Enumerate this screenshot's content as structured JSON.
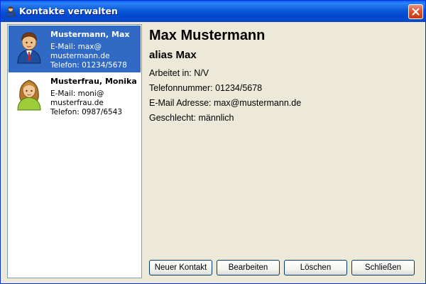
{
  "window": {
    "title": "Kontakte verwalten",
    "icon": "contacts-app-icon"
  },
  "contacts": [
    {
      "name": "Mustermann, Max",
      "email_line1": "E-Mail: max@",
      "email_line2": "mustermann.de",
      "phone": "Telefon: 01234/5678",
      "avatar": "male-user-icon",
      "selected": true
    },
    {
      "name": "Musterfrau, Monika",
      "email_line1": "E-Mail: moni@",
      "email_line2": "musterfrau.de",
      "phone": "Telefon: 0987/6543",
      "avatar": "female-user-icon",
      "selected": false
    }
  ],
  "details": {
    "full_name": "Max Mustermann",
    "alias": "alias Max",
    "works_at": "Arbeitet in: N/V",
    "phone": "Telefonnummer: 01234/5678",
    "email": "E-Mail Adresse: max@mustermann.de",
    "gender": "Geschlecht: männlich"
  },
  "buttons": {
    "new": "Neuer Kontakt",
    "edit": "Bearbeiten",
    "delete": "Löschen",
    "close": "Schließen"
  },
  "colors": {
    "titlebar": "#0a5ef5",
    "window_bg": "#ece9d8",
    "selection": "#316ac5",
    "close_button": "#d8562f"
  }
}
